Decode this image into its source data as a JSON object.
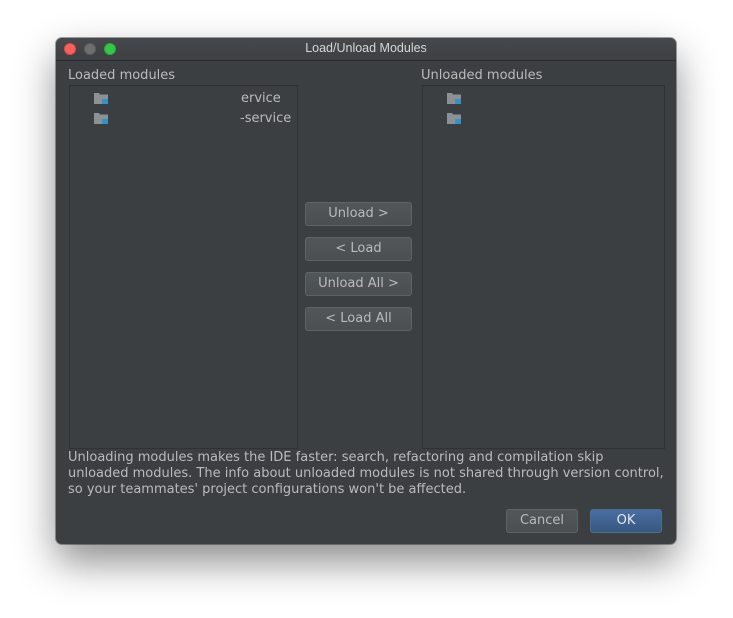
{
  "window": {
    "title": "Load/Unload Modules"
  },
  "loaded": {
    "label": "Loaded modules",
    "items": [
      {
        "name": "ervice",
        "icon": "module-folder-icon"
      },
      {
        "name": "-service",
        "icon": "module-folder-icon"
      }
    ]
  },
  "unloaded": {
    "label": "Unloaded modules",
    "items": [
      {
        "name": "",
        "icon": "module-folder-icon"
      },
      {
        "name": "",
        "icon": "module-folder-icon"
      }
    ]
  },
  "actions": {
    "unload": "Unload >",
    "load": "< Load",
    "unload_all": "Unload All >",
    "load_all": "< Load All"
  },
  "hint": {
    "text": "Unloading modules makes the IDE faster: search, refactoring and compilation skip unloaded modules. The info about unloaded modules is not shared through version control, so your teammates' project configurations won't be affected."
  },
  "footer": {
    "cancel": "Cancel",
    "ok": "OK"
  },
  "colors": {
    "background": "#3c3f41",
    "text": "#bbbbbb",
    "accent": "#365880",
    "close": "#fc605c",
    "maximize": "#34c84a"
  }
}
